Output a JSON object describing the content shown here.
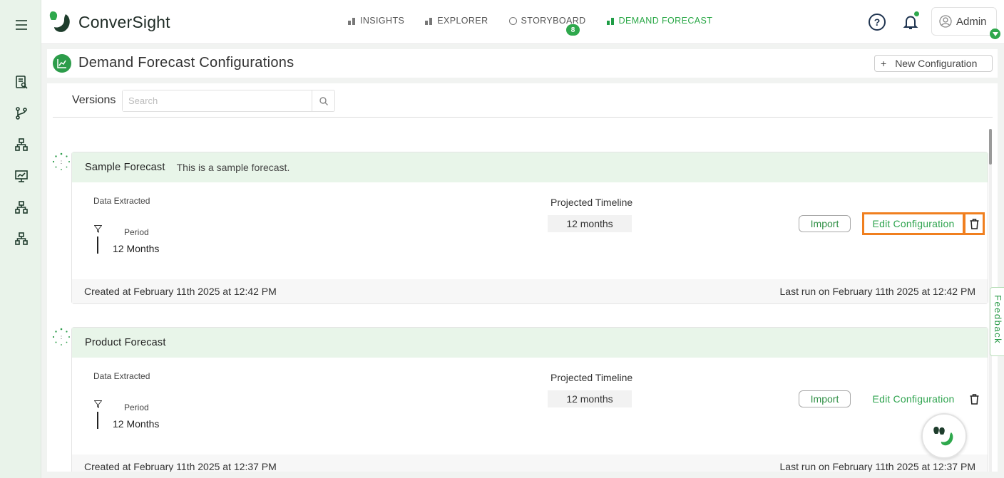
{
  "app": {
    "brand": "ConverSight"
  },
  "nav": {
    "items": [
      {
        "label": "INSIGHTS",
        "active": false
      },
      {
        "label": "EXPLORER",
        "active": false
      },
      {
        "label": "STORYBOARD",
        "active": false
      },
      {
        "label": "DEMAND FORECAST",
        "active": true
      }
    ],
    "storyboard_badge": "8"
  },
  "user": {
    "name": "Admin"
  },
  "page": {
    "title": "Demand Forecast Configurations",
    "new_config_label": "New Configuration",
    "new_config_plus": "+"
  },
  "versions": {
    "label": "Versions",
    "search_placeholder": "Search"
  },
  "forecasts": [
    {
      "name": "Sample Forecast",
      "description": "This is a sample forecast.",
      "data_extracted_label": "Data Extracted",
      "period_label": "Period",
      "period_value": "12 Months",
      "timeline_label": "Projected Timeline",
      "timeline_value": "12 months",
      "import_label": "Import",
      "edit_label": "Edit Configuration",
      "created": "Created at February 11th 2025 at 12:42 PM",
      "last_run": "Last run on February 11th 2025 at 12:42 PM",
      "highlighted": true
    },
    {
      "name": "Product Forecast",
      "description": "",
      "data_extracted_label": "Data Extracted",
      "period_label": "Period",
      "period_value": "12 Months",
      "timeline_label": "Projected Timeline",
      "timeline_value": "12 months",
      "import_label": "Import",
      "edit_label": "Edit Configuration",
      "created": "Created at February 11th 2025 at 12:37 PM",
      "last_run": "Last run on February 11th 2025 at 12:37 PM",
      "highlighted": false
    }
  ],
  "feedback": {
    "label": "Feedback"
  },
  "colors": {
    "brand_green": "#2c9c4a",
    "highlight_orange": "#f07f1f",
    "card_header_bg": "#e8f5e9"
  }
}
